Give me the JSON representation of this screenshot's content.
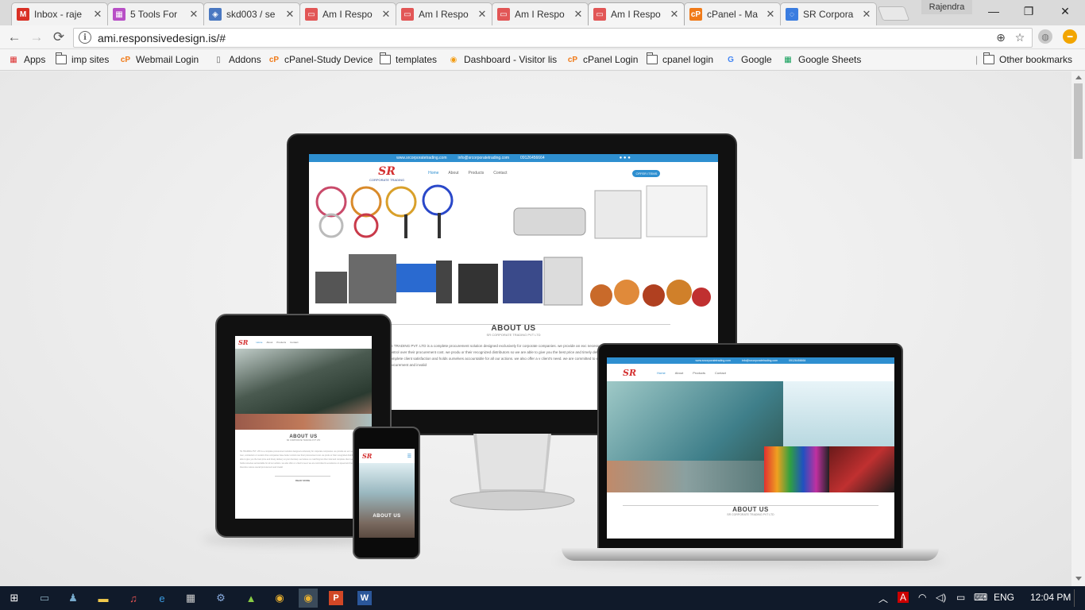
{
  "browser": {
    "tabs": [
      {
        "title": "Inbox - raje",
        "icon": "gmail-icon",
        "color": "#d93025",
        "glyph": "M"
      },
      {
        "title": "5 Tools For",
        "icon": "grid-icon",
        "color": "#b84fc6",
        "glyph": "▦"
      },
      {
        "title": "skd003 / se",
        "icon": "shield-icon",
        "color": "#4a78c1",
        "glyph": "◈"
      },
      {
        "title": "Am I Respo",
        "icon": "ami-icon",
        "color": "#e25656",
        "glyph": "▭"
      },
      {
        "title": "Am I Respo",
        "icon": "ami-icon",
        "color": "#e25656",
        "glyph": "▭"
      },
      {
        "title": "Am I Respo",
        "icon": "ami-icon",
        "color": "#e25656",
        "glyph": "▭"
      },
      {
        "title": "Am I Respo",
        "icon": "ami-icon",
        "color": "#e25656",
        "glyph": "▭"
      },
      {
        "title": "cPanel - Ma",
        "icon": "cpanel-icon",
        "color": "#f07a18",
        "glyph": "cP"
      },
      {
        "title": "SR Corpora",
        "icon": "loading-icon",
        "color": "#3b7de0",
        "glyph": "◌"
      }
    ],
    "active_tab": 6,
    "user_name": "Rajendra",
    "window_buttons": {
      "minimize": "—",
      "restore": "❐",
      "close": "✕"
    },
    "url": "ami.responsivedesign.is/#",
    "bookmarks": [
      {
        "label": "Apps",
        "icon": "apps-grid-icon"
      },
      {
        "label": "imp sites",
        "icon": "folder-icon"
      },
      {
        "label": "Webmail Login",
        "icon": "cpanel-icon"
      },
      {
        "label": "Addons",
        "icon": "page-icon"
      },
      {
        "label": "cPanel-Study Device",
        "icon": "cpanel-icon"
      },
      {
        "label": "templates",
        "icon": "folder-icon"
      },
      {
        "label": "Dashboard - Visitor lis",
        "icon": "dashboard-icon"
      },
      {
        "label": "cPanel Login",
        "icon": "cpanel-icon"
      },
      {
        "label": "cpanel login",
        "icon": "folder-icon"
      },
      {
        "label": "Google",
        "icon": "google-icon"
      },
      {
        "label": "Google Sheets",
        "icon": "sheets-icon"
      }
    ],
    "other_bookmarks": "Other bookmarks"
  },
  "site": {
    "website": "www.srcorporatetrading.com",
    "email": "info@srcorporatetrading.com",
    "phone": "09126456664",
    "logo_text": "SR",
    "logo_sub": "CORPORATE TRADING",
    "nav": [
      "Home",
      "About",
      "Products",
      "Contact"
    ],
    "badge": "OFFER ITEMS",
    "about_title": "ABOUT US",
    "about_sub": "SR CORPORATE TRADING PVT LTD",
    "about_body": "TE TRADING PVT. LTD is a complete procurement solution designed exclusively for corporate companies. we provide an exc necessary middle men, contractors or vendors thus companies have better control over their procurement cost. we produ or their recognized distributors so we are able to give you the best price and timely delivery at your doorstep. we believe cu matching two then total and complete client satisfaction and holds ourselves accountable for all our actions. we also offer a v client's need. we are committed to excellence on speed and transparency therefore reduce overall procurement and invalid",
    "tablet_button": "READ MORE"
  },
  "taskbar": {
    "apps": [
      "windows-start-icon",
      "tablet-mode-icon",
      "people-icon",
      "file-explorer-icon",
      "itunes-icon",
      "edge-icon",
      "calculator-icon",
      "settings-icon",
      "android-icon",
      "chrome-icon",
      "chrome-icon",
      "powerpoint-icon",
      "word-icon"
    ],
    "language": "ENG",
    "time": "12:04 PM"
  },
  "colors": {
    "accent": "#2e8fd0",
    "taskbar": "#101a2a"
  }
}
